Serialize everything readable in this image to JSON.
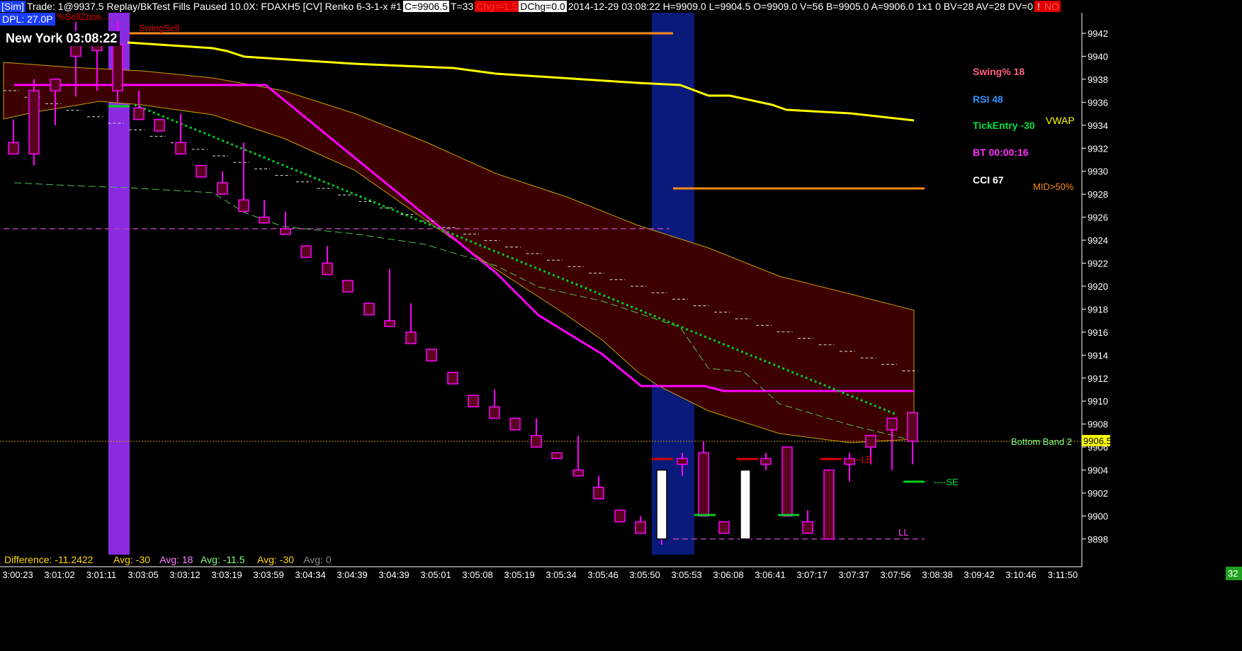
{
  "header": {
    "sim": "[Sim]",
    "trade": "Trade: 1@9937.5",
    "mode": "Replay/BkTest Fills Paused 10.0X: FDAXH5 [CV]  Renko 6-3-1-x  #1",
    "close": "C=9906.5",
    "ticks": "T=33",
    "chg": "Chg=-1.5",
    "dchg": "DChg=0.0",
    "info": "2014-12-29 03:08:22 H=9909.0 L=9904.5 O=9909.0 V=56 B=9905.0 A=9906.0 1x1 0 BV=28 AV=28 DV=0",
    "flag_left": "!",
    "flag_right": "NO"
  },
  "dpl": "DPL: 27.0P",
  "sell_zone": "%SellZone....",
  "swing_sell": "SwingSell",
  "clock": "New York 03:08:22",
  "colors": {
    "bg": "#000000",
    "up": "#ff00ff",
    "band_fill": "#3d0000",
    "vwap": "#ffff00",
    "orange": "#ff8c1a",
    "green": "#00e040",
    "purple": "#8a2be2",
    "navy": "#0a1a7a"
  },
  "right_labels": {
    "swing": "Swing% 18",
    "rsi": "RSI 48",
    "tick_entry": "TickEntry -30",
    "bt": "BT 00:00:16",
    "cci": "CCI 67",
    "vwap": "VWAP",
    "mid": "MID>50%",
    "bottom_band": "Bottom Band 2",
    "le": "----LE",
    "se": "----SE",
    "ll": "LL",
    "price_tag": "9906.5",
    "corner": "32"
  },
  "bottom_stats": [
    {
      "label": "Difference: -11.2422",
      "color": "#ffd700"
    },
    {
      "label": "Avg: -30",
      "color": "#ffd700"
    },
    {
      "label": "Avg: 18",
      "color": "#ff80ff"
    },
    {
      "label": "Avg: -11.5",
      "color": "#80ff80"
    },
    {
      "label": "Avg: -30",
      "color": "#ffd700"
    },
    {
      "label": "Avg: 0",
      "color": "#888888"
    }
  ],
  "chart_data": {
    "type": "candlestick",
    "symbol": "FDAXH5",
    "y_ticks": [
      9898,
      9900,
      9902,
      9904,
      9906,
      9908,
      9910,
      9912,
      9914,
      9916,
      9918,
      9920,
      9922,
      9924,
      9926,
      9928,
      9930,
      9932,
      9934,
      9936,
      9938,
      9940,
      9942
    ],
    "ylim": [
      9896.2,
      9943.2
    ],
    "x_ticks": [
      "3:00:23",
      "3:01:02",
      "3:01:11",
      "3:03:05",
      "3:03:12",
      "3:03:19",
      "3:03:59",
      "3:04:34",
      "3:04:39",
      "3:04:39",
      "3:05:01",
      "3:05:08",
      "3:05:19",
      "3:05:34",
      "3:05:46",
      "3:05:50",
      "3:05:53",
      "3:06:08",
      "3:06:41",
      "3:07:17",
      "3:07:37",
      "3:07:56",
      "3:08:38",
      "3:09:42",
      "3:10:46",
      "3:11:50"
    ],
    "candles": [
      {
        "x": 19,
        "o": 9932.5,
        "h": 9934.5,
        "l": 9932.5,
        "c": 9931.5,
        "hi": 9935.5
      },
      {
        "x": 48,
        "o": 9937.0,
        "h": 9938.0,
        "l": 9930.5,
        "c": 9931.5
      },
      {
        "x": 78,
        "o": 9938.0,
        "h": 9938.0,
        "l": 9934.0,
        "c": 9937.0
      },
      {
        "x": 107,
        "o": 9941.0,
        "h": 9943.0,
        "l": 9936.5,
        "c": 9940.0
      },
      {
        "x": 137,
        "o": 9941.0,
        "h": 9942.0,
        "l": 9937.0,
        "c": 9940.5
      },
      {
        "x": 166,
        "o": 9941.0,
        "h": 9943.0,
        "l": 9936.0,
        "c": 9937.0
      },
      {
        "x": 196,
        "o": 9935.5,
        "h": 9937.0,
        "l": 9934.5,
        "c": 9934.5
      },
      {
        "x": 225,
        "o": 9934.5,
        "h": 9934.5,
        "l": 9933.5,
        "c": 9933.5
      },
      {
        "x": 255,
        "o": 9932.5,
        "h": 9935.0,
        "l": 9931.5,
        "c": 9931.5
      },
      {
        "x": 284,
        "o": 9930.5,
        "h": 9930.5,
        "l": 9929.5,
        "c": 9929.5
      },
      {
        "x": 314,
        "o": 9929.0,
        "h": 9930.0,
        "l": 9928.0,
        "c": 9928.0
      },
      {
        "x": 344,
        "o": 9927.5,
        "h": 9932.5,
        "l": 9926.5,
        "c": 9926.5
      },
      {
        "x": 373,
        "o": 9926.0,
        "h": 9927.5,
        "l": 9925.5,
        "c": 9925.5
      },
      {
        "x": 403,
        "o": 9925.0,
        "h": 9926.5,
        "l": 9924.5,
        "c": 9924.5
      },
      {
        "x": 432,
        "o": 9923.5,
        "h": 9923.5,
        "l": 9922.5,
        "c": 9922.5
      },
      {
        "x": 462,
        "o": 9922.0,
        "h": 9923.5,
        "l": 9921.0,
        "c": 9921.0
      },
      {
        "x": 491,
        "o": 9920.5,
        "h": 9920.5,
        "l": 9919.5,
        "c": 9919.5
      },
      {
        "x": 521,
        "o": 9918.5,
        "h": 9918.5,
        "l": 9917.5,
        "c": 9917.5
      },
      {
        "x": 550,
        "o": 9917.0,
        "h": 9921.5,
        "l": 9916.5,
        "c": 9916.5
      },
      {
        "x": 580,
        "o": 9916.0,
        "h": 9918.5,
        "l": 9915.0,
        "c": 9915.0
      },
      {
        "x": 609,
        "o": 9914.5,
        "h": 9914.5,
        "l": 9913.5,
        "c": 9913.5
      },
      {
        "x": 639,
        "o": 9912.5,
        "h": 9912.5,
        "l": 9911.5,
        "c": 9911.5
      },
      {
        "x": 668,
        "o": 9910.5,
        "h": 9910.5,
        "l": 9909.5,
        "c": 9909.5
      },
      {
        "x": 698,
        "o": 9909.5,
        "h": 9911.0,
        "l": 9908.5,
        "c": 9908.5
      },
      {
        "x": 727,
        "o": 9908.5,
        "h": 9908.5,
        "l": 9907.5,
        "c": 9907.5
      },
      {
        "x": 757,
        "o": 9907.0,
        "h": 9908.5,
        "l": 9906.0,
        "c": 9906.0
      },
      {
        "x": 786,
        "o": 9905.5,
        "h": 9905.5,
        "l": 9905.0,
        "c": 9905.0
      },
      {
        "x": 816,
        "o": 9904.0,
        "h": 9907.0,
        "l": 9903.5,
        "c": 9903.5
      },
      {
        "x": 845,
        "o": 9902.5,
        "h": 9903.5,
        "l": 9901.5,
        "c": 9901.5
      },
      {
        "x": 875,
        "o": 9900.5,
        "h": 9900.5,
        "l": 9899.5,
        "c": 9899.5
      },
      {
        "x": 904,
        "o": 9899.5,
        "h": 9900.0,
        "l": 9898.5,
        "c": 9898.5
      },
      {
        "x": 934,
        "o": 9898.0,
        "h": 9904.0,
        "l": 9897.5,
        "c": 9904.0,
        "up": true
      },
      {
        "x": 963,
        "o": 9904.5,
        "h": 9905.5,
        "l": 9903.5,
        "c": 9905.0
      },
      {
        "x": 993,
        "o": 9905.5,
        "h": 9906.5,
        "l": 9900.0,
        "c": 9900.0
      },
      {
        "x": 1022,
        "o": 9899.5,
        "h": 9899.5,
        "l": 9898.5,
        "c": 9898.5
      },
      {
        "x": 1052,
        "o": 9898.0,
        "h": 9904.0,
        "l": 9898.0,
        "c": 9904.0,
        "up": true
      },
      {
        "x": 1081,
        "o": 9905.0,
        "h": 9905.5,
        "l": 9904.0,
        "c": 9904.5
      },
      {
        "x": 1111,
        "o": 9906.0,
        "h": 9906.0,
        "l": 9900.0,
        "c": 9900.0
      },
      {
        "x": 1140,
        "o": 9899.5,
        "h": 9900.5,
        "l": 9898.5,
        "c": 9898.5
      },
      {
        "x": 1170,
        "o": 9904.0,
        "h": 9904.0,
        "l": 9898.0,
        "c": 9898.0
      },
      {
        "x": 1199,
        "o": 9905.0,
        "h": 9905.5,
        "l": 9903.0,
        "c": 9904.5
      },
      {
        "x": 1229,
        "o": 9907.0,
        "h": 9907.0,
        "l": 9904.5,
        "c": 9906.0
      },
      {
        "x": 1259,
        "o": 9908.5,
        "h": 9908.5,
        "l": 9904.0,
        "c": 9907.5
      },
      {
        "x": 1288,
        "o": 9909.0,
        "h": 9909.0,
        "l": 9904.5,
        "c": 9906.5
      }
    ],
    "levels": {
      "orange_top": 9942.0,
      "orange_mid": 9928.5,
      "magenta_dash": 9925.0,
      "dotted_yellow": 9906.5,
      "ll": 9898.0
    }
  }
}
